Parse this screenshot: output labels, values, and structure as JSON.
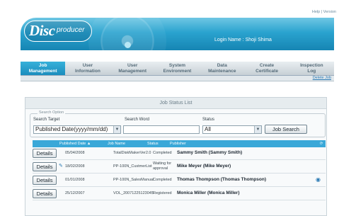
{
  "top_links": "Help | Version",
  "banner": {
    "logo_disc": "Disc",
    "logo_producer": "producer",
    "login_text": "Login Name : Shoji Shima"
  },
  "nav": {
    "tabs": [
      {
        "line1": "Job",
        "line2": "Management",
        "active": true
      },
      {
        "line1": "User",
        "line2": "Information"
      },
      {
        "line1": "User",
        "line2": "Management"
      },
      {
        "line1": "System",
        "line2": "Environment"
      },
      {
        "line1": "Data",
        "line2": "Maintenance"
      },
      {
        "line1": "Create",
        "line2": "Certificate"
      },
      {
        "line1": "Inspection",
        "line2": "Log"
      }
    ],
    "delete_job": "Delete Job"
  },
  "panel_title": "Job Status List",
  "search": {
    "legend": "Search Option",
    "target_label": "Search Target",
    "target_value": "Published Date(yyyy/mm/dd)",
    "word_label": "Search Word",
    "word_value": "",
    "status_label": "Status",
    "status_value": "All",
    "button": "Job Search"
  },
  "table": {
    "headers": [
      "Published Date ▲",
      "Job Name",
      "Status",
      "Publisher"
    ],
    "rows": [
      {
        "details": "Details",
        "date": "05/04/2008",
        "job": "TotalDiskMakerVer2.0",
        "status1": "Completed",
        "status2": "",
        "publisher": "Sammy Smith (Sammy Smith)"
      },
      {
        "details": "Details",
        "date": "18/02/2008",
        "job": "PP-100N_CustmerList",
        "status1": "Waiting for",
        "status2": "approval",
        "publisher": "Mike Meyer (Mike Meyer)"
      },
      {
        "details": "Details",
        "date": "01/01/2008",
        "job": "PP-100N_SalesManual",
        "status1": "Completed",
        "status2": "",
        "publisher": "Thomas Thompson (Thomas Thompson)"
      },
      {
        "details": "Details",
        "date": "25/12/2007",
        "job": "VOL_20071225123045",
        "status1": "Registered",
        "status2": "",
        "publisher": "Monica Miller (Monica Miller)"
      }
    ]
  },
  "colors": {
    "accent": "#2aa3cf",
    "header": "#3aa8d8"
  }
}
